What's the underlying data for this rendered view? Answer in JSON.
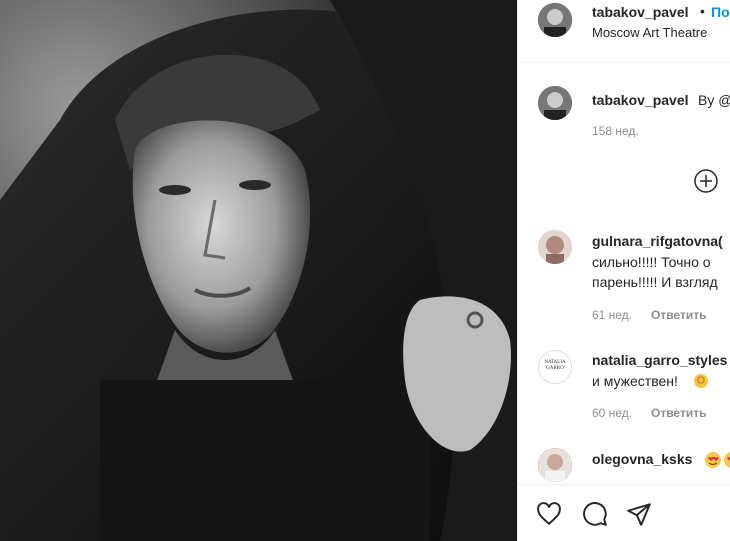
{
  "header": {
    "username": "tabakov_pavel",
    "bullet": "•",
    "follow_label": "По",
    "location": "Moscow Art Theatre"
  },
  "caption": {
    "username": "tabakov_pavel",
    "text": "By @",
    "time": "158 нед."
  },
  "comments": [
    {
      "username": "gulnara_rifgatovna(",
      "line1": "сильно!!!!! Точно о",
      "line2": "парень!!!!! И взгляд",
      "time": "61 нед.",
      "reply": "Ответить"
    },
    {
      "username": "natalia_garro_styles",
      "line1": "и мужествен!",
      "time": "60 нед.",
      "reply": "Ответить",
      "avatar_text": "NATALIA GARRO"
    },
    {
      "username": "olegovna_ksks"
    }
  ],
  "colors": {
    "accent": "#0095f6",
    "muted": "#8e8e8e",
    "text": "#262626",
    "border": "#efefef"
  },
  "icons": [
    "add-comment-plus-icon",
    "heart-icon",
    "comment-icon",
    "share-icon"
  ]
}
